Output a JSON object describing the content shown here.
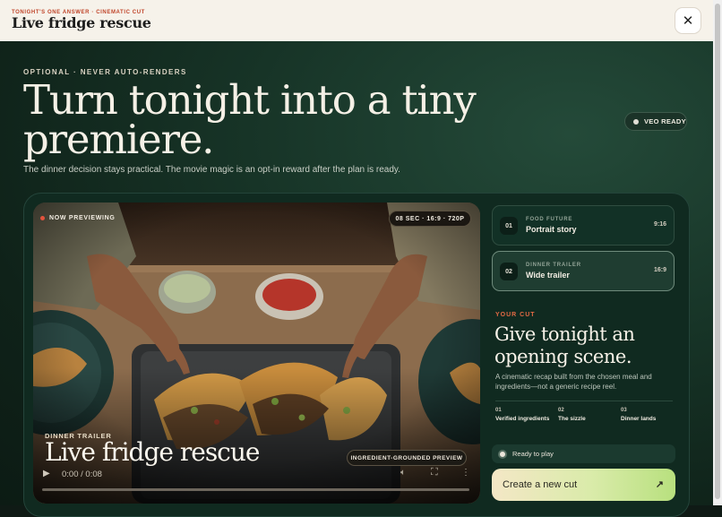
{
  "header": {
    "eyebrow": "TONIGHT'S ONE ANSWER · CINEMATIC CUT",
    "title": "Live fridge rescue",
    "close_glyph": "✕"
  },
  "hero": {
    "kicker": "OPTIONAL · NEVER AUTO-RENDERS",
    "headline": "Turn tonight into a tiny premiere.",
    "subline": "The dinner decision stays practical. The movie magic is an opt-in reward after the plan is ready.",
    "status_badge": "VEO READY"
  },
  "player": {
    "now_previewing": "NOW PREVIEWING",
    "spec": "08 SEC · 16:9 · 720P",
    "kicker": "DINNER TRAILER",
    "title": "Live fridge rescue",
    "preview_badge": "INGREDIENT-GROUNDED PREVIEW",
    "time": "0:00 / 0:08",
    "progress": 0
  },
  "cuts": [
    {
      "num": "01",
      "kicker": "FOOD FUTURE",
      "name": "Portrait story",
      "ratio": "9:16"
    },
    {
      "num": "02",
      "kicker": "DINNER TRAILER",
      "name": "Wide trailer",
      "ratio": "16:9"
    }
  ],
  "your_cut": {
    "kicker": "YOUR CUT",
    "headline": "Give tonight an opening scene.",
    "description": "A cinematic recap built from the chosen meal and ingredients—not a generic recipe reel.",
    "steps": [
      {
        "num": "01",
        "label": "Verified ingredients"
      },
      {
        "num": "02",
        "label": "The sizzle"
      },
      {
        "num": "03",
        "label": "Dinner lands"
      }
    ],
    "status": "Ready to play",
    "cta": "Create a new cut",
    "cta_icon": "↗"
  },
  "colors": {
    "accent": "#e36a44",
    "brand_dark": "#102a20",
    "cta_start": "#f4e7c6",
    "cta_end": "#b8e07e"
  }
}
